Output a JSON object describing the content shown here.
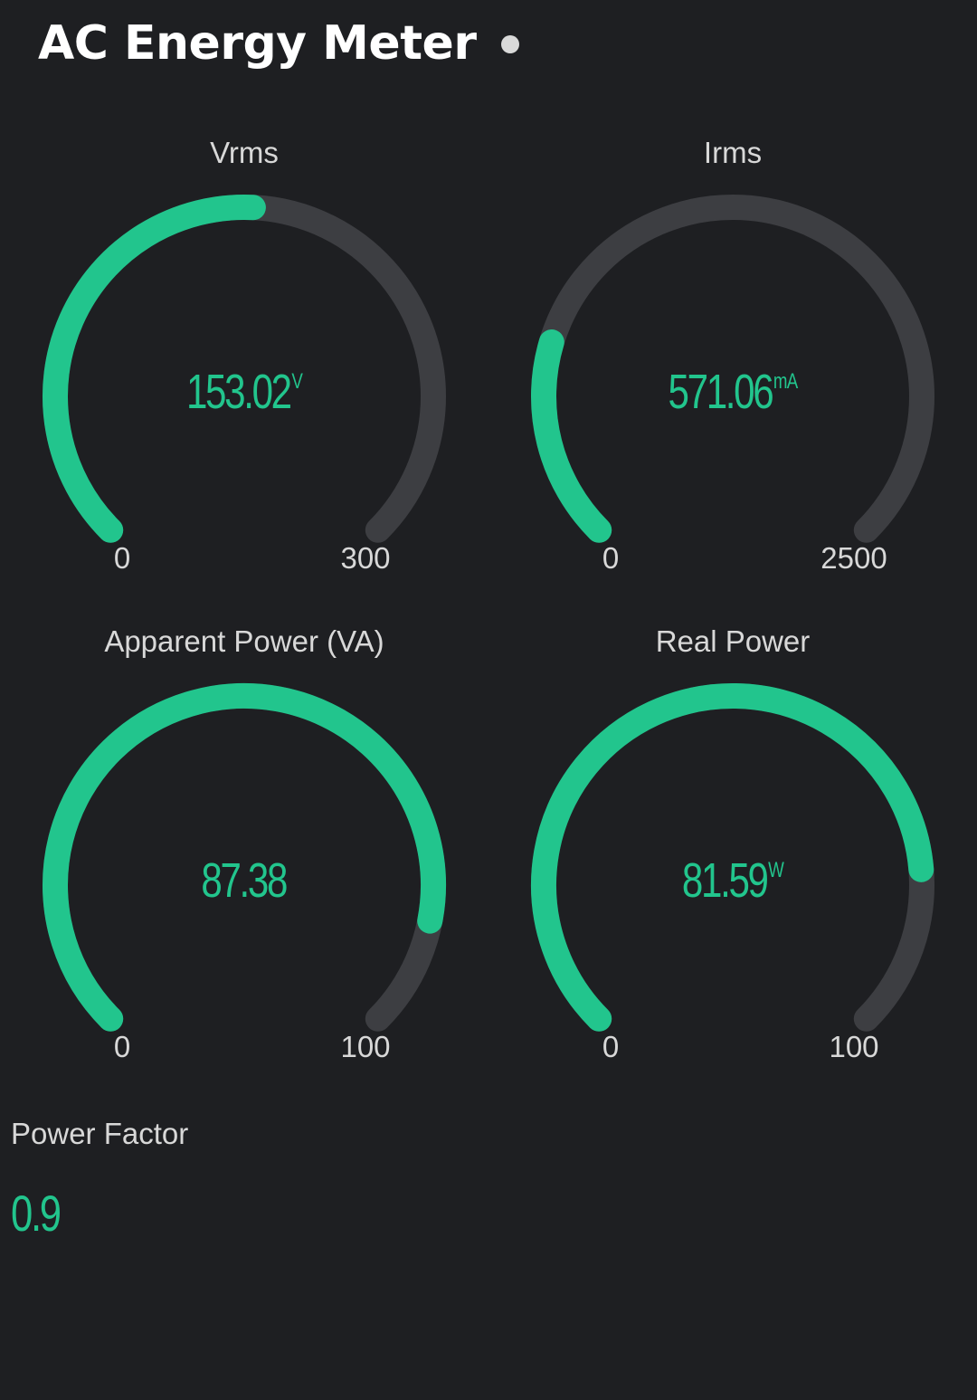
{
  "app": {
    "title": "AC Energy Meter",
    "status_dot_color": "#d9d9d9"
  },
  "colors": {
    "accent": "#22c58d",
    "track": "#3d3e42",
    "background": "#1e1f22"
  },
  "gauges": [
    {
      "id": "vrms",
      "title": "Vrms",
      "value_text": "153.02",
      "unit": "V",
      "value": 153.02,
      "min": 0,
      "max": 300,
      "min_label": "0",
      "max_label": "300"
    },
    {
      "id": "irms",
      "title": "Irms",
      "value_text": "571.06",
      "unit": "mA",
      "value": 571.06,
      "min": 0,
      "max": 2500,
      "min_label": "0",
      "max_label": "2500"
    },
    {
      "id": "apparent",
      "title": "Apparent Power (VA)",
      "value_text": "87.38",
      "unit": "",
      "value": 87.38,
      "min": 0,
      "max": 100,
      "min_label": "0",
      "max_label": "100"
    },
    {
      "id": "real",
      "title": "Real Power",
      "value_text": "81.59",
      "unit": "W",
      "value": 81.59,
      "min": 0,
      "max": 100,
      "min_label": "0",
      "max_label": "100"
    }
  ],
  "power_factor": {
    "label": "Power Factor",
    "value": "0.9"
  }
}
